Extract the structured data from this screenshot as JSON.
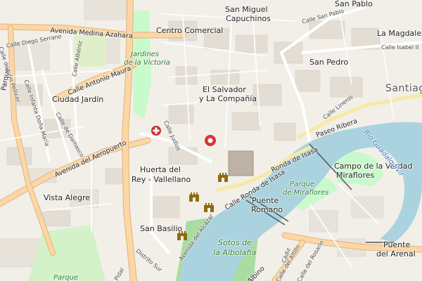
{
  "map": {
    "colors": {
      "background": "#f2efe9",
      "water": "#aad3df",
      "park": "#c8facc",
      "major_road": "#fcd6a4",
      "road_casing": "#e0b47e",
      "primary_road": "#f7e9a5",
      "pin": "#d9333a",
      "hospital": "#c4312b",
      "monument": "#8d6b10"
    },
    "labels": {
      "districts": {
        "san_miguel": "San Miguel",
        "capuchinos": "Capuchinos",
        "san_pablo": "San Pablo",
        "la_magdalena": "La Magdalena",
        "centro_comercial": "Centro Comercial",
        "san_pedro": "San Pedro",
        "santiago": "Santiago",
        "el_salvador": "El Salvador",
        "y_la_compania": "y La Compañía",
        "ciudad_jardin": "Ciudad Jardín",
        "huerta_del": "Huerta del",
        "rey_vallellano": "Rey - Vallellano",
        "vista_alegre": "Vista Alegre",
        "san_basilio": "San Basilio",
        "campo_de_la_verdad": "Campo de la Verdad",
        "miraflores": "Miraflores",
        "puente_romano_1": "Puente",
        "puente_romano_2": "Romano",
        "puente_arenal_1": "Puente",
        "puente_arenal_2": "del Arenal"
      },
      "parks": {
        "jardines_1": "Jardines",
        "jardines_2": "de la Victoria",
        "parque_1": "Parque",
        "parque_2": "de Miraflores",
        "sotos_1": "Sotos de",
        "sotos_2": "la Albolafia",
        "parque_bottom": "Parque"
      },
      "water": {
        "rio_1": "Río Guadalquivir"
      },
      "roads": {
        "av_medina_azahara": "Avenida Medina Azahara",
        "av_antonio_maura": "Calle Antonio Maura",
        "av_aeropuerto": "Avenida del Aeropuerto",
        "ronda_isasa": "Ronda de Isasa",
        "calle_ronda_isasa": "Calle Ronda de Isasa",
        "paseo_ribera": "Paseo Ribera",
        "calle_lineros": "Calle Lineros",
        "calle_san_pablo": "Calle San Pablo",
        "calle_isabel": "Calle Isabel II",
        "calle_diego_serrano": "Calle Diego Serrano",
        "calle_albeniz": "Calle Albéniz",
        "calle_julio_pellicer": "Calle de Julio Pellicer",
        "calle_infanta": "Calle Infanta Doña María",
        "calle_damasco": "Calle de Damasco",
        "calle_judios": "Calle Judíos",
        "avenida_alcazar": "Avenida del Alcázar",
        "distrito_sur": "Distrito Sur",
        "parque_left": "Parque",
        "av_pidal": "Pidal",
        "av_albino": "Albino",
        "calle_altillo": "Calle del Altillo",
        "calle_rosario": "Calle del Rosario",
        "calle_cadiz": "Cádiz"
      }
    },
    "pois": {
      "pin": "location-pin-icon",
      "hospital": "hospital-icon",
      "monument": "castle-monument-icon"
    }
  }
}
